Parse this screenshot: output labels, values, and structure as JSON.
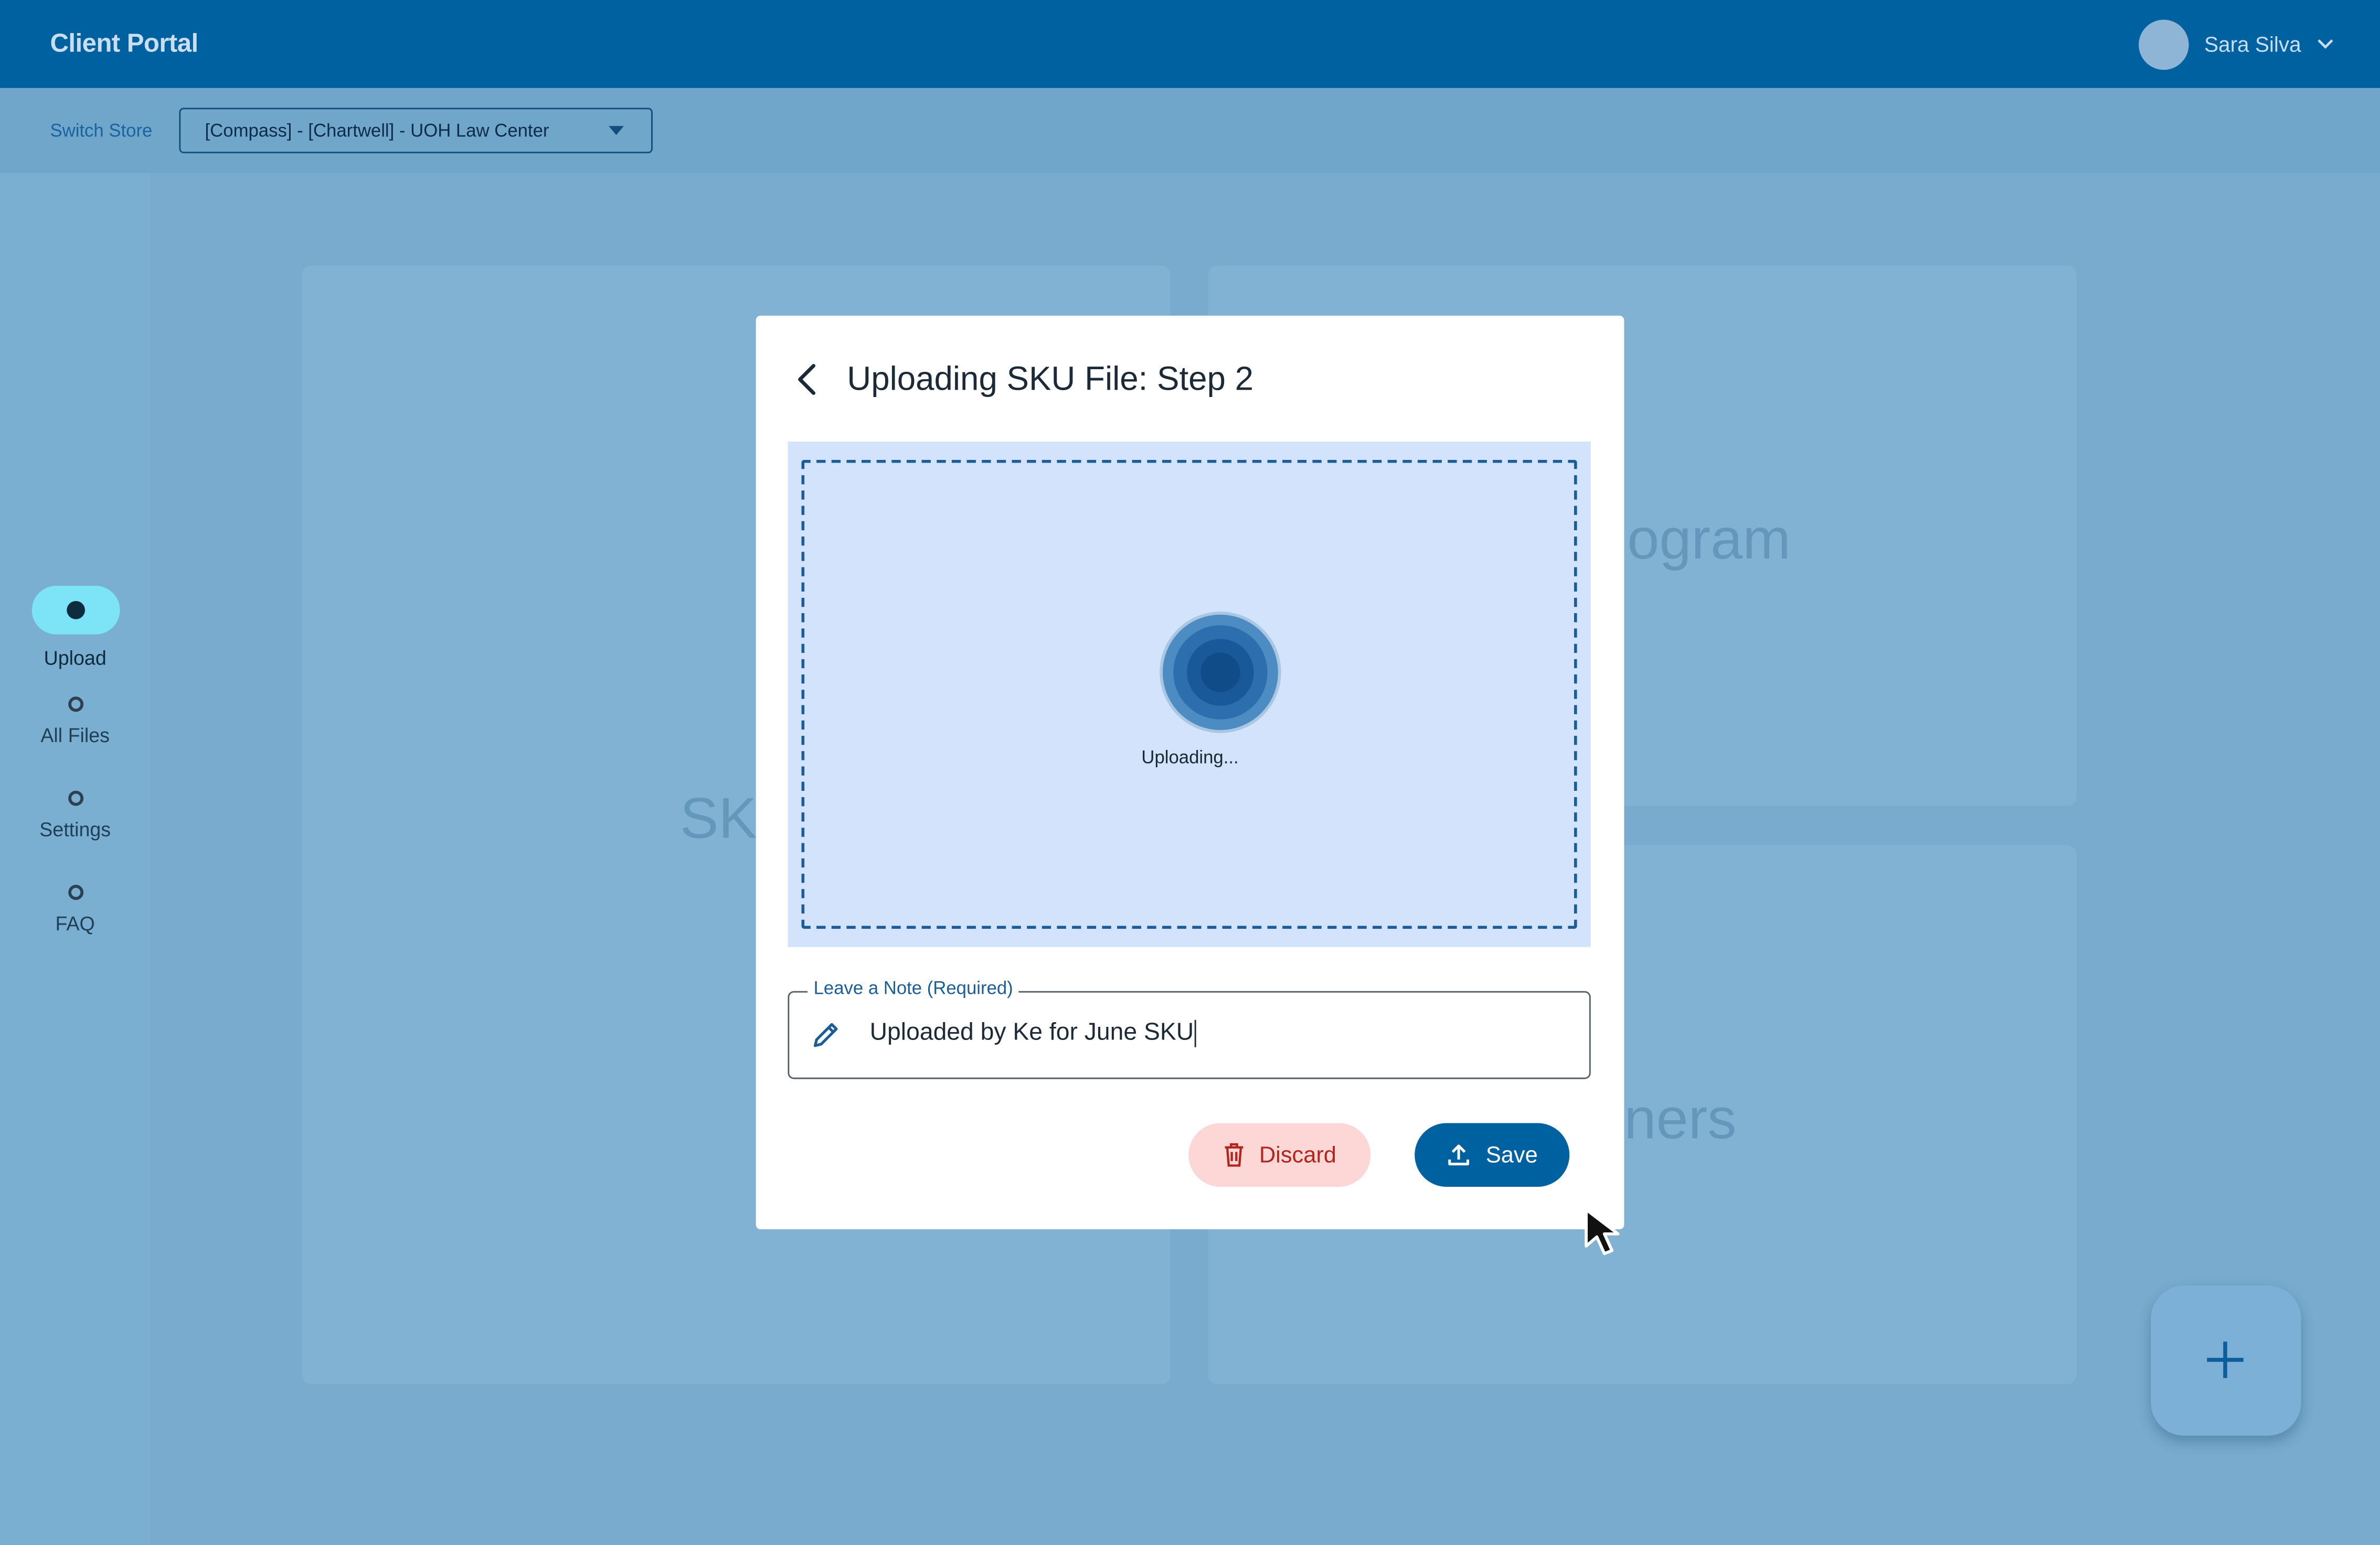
{
  "app": {
    "title": "Client Portal"
  },
  "user": {
    "name": "Sara Silva"
  },
  "store": {
    "switch_label": "Switch Store",
    "selected": "[Compass] - [Chartwell] - UOH Law Center"
  },
  "sidenav": {
    "items": [
      {
        "label": "Upload",
        "active": true
      },
      {
        "label": "All Files",
        "active": false
      },
      {
        "label": "Settings",
        "active": false
      },
      {
        "label": "FAQ",
        "active": false
      }
    ]
  },
  "background": {
    "card_texts": [
      "SK",
      "ogram",
      "ners"
    ]
  },
  "modal": {
    "title": "Uploading SKU File: Step 2",
    "status_text": "Uploading...",
    "note": {
      "label": "Leave a Note (Required)",
      "value": "Uploaded by Ke for June SKU"
    },
    "buttons": {
      "discard": "Discard",
      "save": "Save"
    }
  },
  "colors": {
    "primary": "#0061a1",
    "danger": "#b3261e",
    "danger_bg": "#fcd7d6",
    "dropzone_bg": "#d2e3fb",
    "active_nav": "#7de3f7"
  },
  "icons": [
    "chevron-down-icon",
    "back-arrow-icon",
    "spinner-icon",
    "pencil-icon",
    "trash-icon",
    "upload-icon",
    "plus-icon",
    "mouse-cursor-icon"
  ]
}
